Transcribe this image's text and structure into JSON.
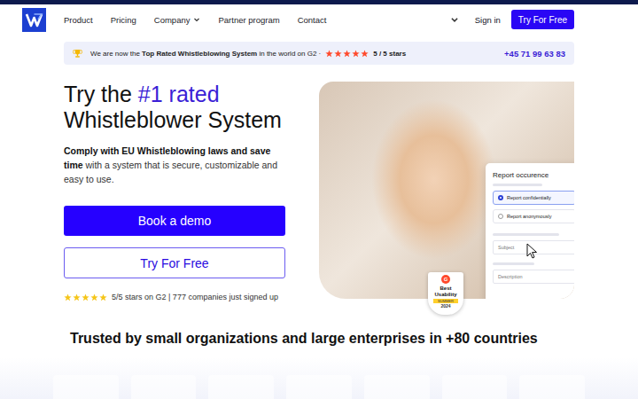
{
  "nav": {
    "links": [
      {
        "label": "Product",
        "kind": "link"
      },
      {
        "label": "Pricing",
        "kind": "link"
      },
      {
        "label": "Company",
        "kind": "menu"
      },
      {
        "label": "Partner program",
        "kind": "link"
      },
      {
        "label": "Contact",
        "kind": "link"
      }
    ],
    "sign_in": "Sign in",
    "cta": "Try For Free"
  },
  "banner": {
    "prefix": "We are now the ",
    "strong": "Top Rated Whistleblowing System",
    "suffix": " in the world on G2 ·",
    "stars": 5,
    "rating": "5 / 5 stars",
    "phone": "+45 71 99 63 83"
  },
  "hero": {
    "title_prefix": "Try the ",
    "title_highlight": "#1 rated",
    "title_line2": "Whistleblower System",
    "lead_strong": "Comply with EU Whistleblowing laws and save time",
    "lead_rest": " with a system that is secure, customizable and easy to use.",
    "primary_button": "Book a demo",
    "secondary_button": "Try For Free",
    "rating": {
      "stars": 5,
      "text": "5/5 stars on G2 | 777 companies just signed up"
    }
  },
  "form": {
    "title": "Report occurence",
    "options": [
      {
        "label": "Report confidentially",
        "selected": true
      },
      {
        "label": "Report anonymously",
        "selected": false
      }
    ],
    "fields": [
      "Subject",
      "Description"
    ]
  },
  "badge": {
    "brand": "G",
    "line1": "Best",
    "line2": "Usability",
    "season": "SUMMER",
    "year": "2024"
  },
  "trusted": "Trusted by small organizations and large enterprises in +80 countries"
}
